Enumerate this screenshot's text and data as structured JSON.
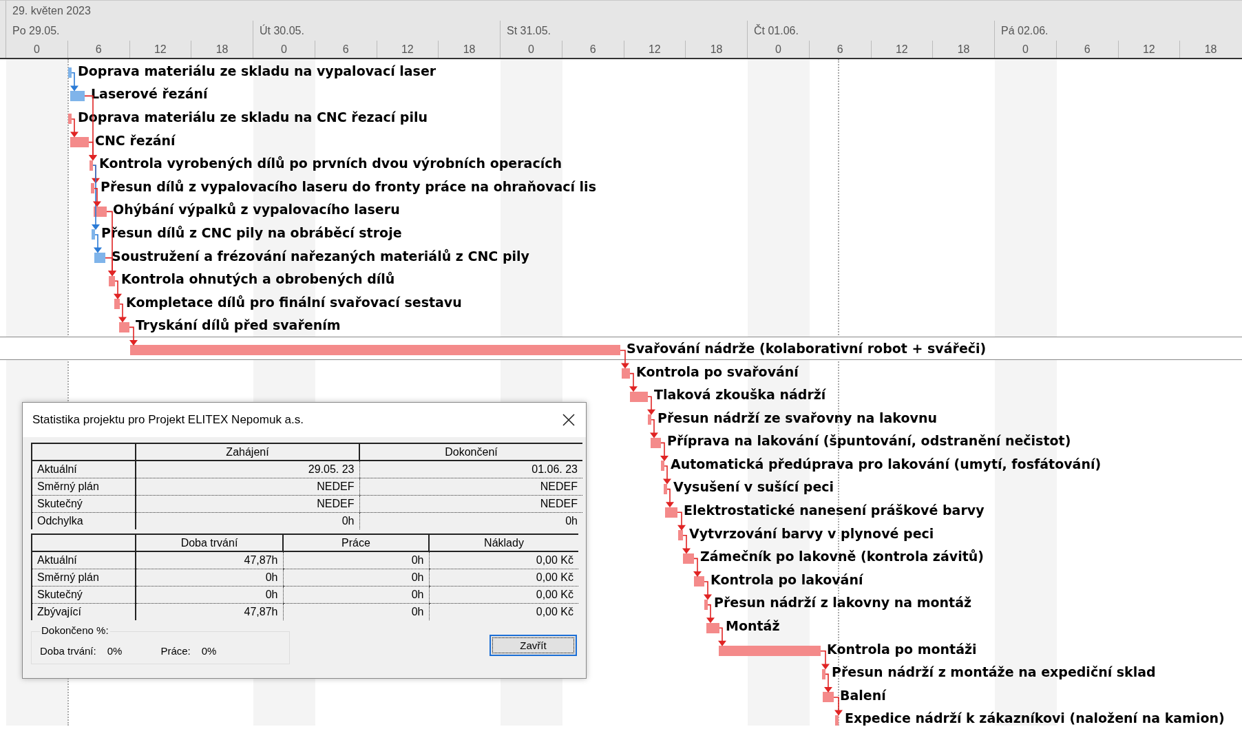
{
  "timescale": {
    "month": "29. květen 2023",
    "days": [
      {
        "label": "Po 29.05.",
        "hours": [
          "0",
          "6",
          "12",
          "18"
        ]
      },
      {
        "label": "Út 30.05.",
        "hours": [
          "0",
          "6",
          "12",
          "18"
        ]
      },
      {
        "label": "St 31.05.",
        "hours": [
          "0",
          "6",
          "12",
          "18"
        ]
      },
      {
        "label": "Čt 01.06.",
        "hours": [
          "0",
          "6",
          "12",
          "18"
        ]
      },
      {
        "label": "Pá 02.06.",
        "hours": [
          "0",
          "6",
          "12",
          "18"
        ]
      }
    ]
  },
  "tasks": [
    {
      "name": "Doprava materiálu ze skladu na vypalovací laser",
      "critical": false,
      "selected": false
    },
    {
      "name": "Laserové řezání",
      "critical": false,
      "selected": false
    },
    {
      "name": "Doprava materiálu ze skladu na CNC řezací pilu",
      "critical": true,
      "selected": false
    },
    {
      "name": "CNC řezání",
      "critical": true,
      "selected": false
    },
    {
      "name": "Kontrola vyrobených dílů po prvních dvou výrobních operacích",
      "critical": true,
      "selected": false
    },
    {
      "name": "Přesun dílů z vypalovacího laseru do fronty práce na ohraňovací lis",
      "critical": true,
      "selected": false
    },
    {
      "name": "Ohýbání výpalků z vypalovacího laseru",
      "critical": true,
      "selected": false
    },
    {
      "name": "Přesun dílů z CNC pily na obráběcí stroje",
      "critical": false,
      "selected": false
    },
    {
      "name": "Soustružení a frézování nařezaných materiálů z CNC pily",
      "critical": false,
      "selected": false
    },
    {
      "name": "Kontrola ohnutých a obrobených dílů",
      "critical": true,
      "selected": false
    },
    {
      "name": "Kompletace dílů pro finální svařovací sestavu",
      "critical": true,
      "selected": false
    },
    {
      "name": "Tryskání dílů před svařením",
      "critical": true,
      "selected": false
    },
    {
      "name": "Svařování nádrže (kolaborativní robot + svářeči)",
      "critical": true,
      "selected": true
    },
    {
      "name": "Kontrola po svařování",
      "critical": true,
      "selected": false
    },
    {
      "name": "Tlaková zkouška nádrží",
      "critical": true,
      "selected": false
    },
    {
      "name": "Přesun nádrží ze svařovny na lakovnu",
      "critical": true,
      "selected": false
    },
    {
      "name": "Příprava na lakování (špuntování, odstranění nečistot)",
      "critical": true,
      "selected": false
    },
    {
      "name": "Automatická předúprava pro lakování (umytí, fosfátování)",
      "critical": true,
      "selected": false
    },
    {
      "name": "Vysušení v sušící peci",
      "critical": true,
      "selected": false
    },
    {
      "name": "Elektrostatické nanesení práškové barvy",
      "critical": true,
      "selected": false
    },
    {
      "name": "Vytvrzování barvy v plynové peci",
      "critical": true,
      "selected": false
    },
    {
      "name": "Zámečník po lakovně (kontrola závitů)",
      "critical": true,
      "selected": false
    },
    {
      "name": "Kontrola po lakování",
      "critical": true,
      "selected": false
    },
    {
      "name": "Přesun nádrží z lakovny na montáž",
      "critical": true,
      "selected": false
    },
    {
      "name": "Montáž",
      "critical": true,
      "selected": false
    },
    {
      "name": "Kontrola po montáži",
      "critical": true,
      "selected": false
    },
    {
      "name": "Přesun nádrží z montáže na expediční sklad",
      "critical": true,
      "selected": false
    },
    {
      "name": "Balení",
      "critical": true,
      "selected": false
    },
    {
      "name": "Expedice nádrží k zákazníkovi (naložení na kamion)",
      "critical": true,
      "selected": false
    }
  ],
  "dialog": {
    "title": "Statistika projektu pro Projekt ELITEX Nepomuk a.s.",
    "dates_table": {
      "columns": [
        "Zahájení",
        "Dokončení"
      ],
      "rows": [
        {
          "label": "Aktuální",
          "values": [
            "29.05. 23",
            "01.06. 23"
          ]
        },
        {
          "label": "Směrný plán",
          "values": [
            "NEDEF",
            "NEDEF"
          ]
        },
        {
          "label": "Skutečný",
          "values": [
            "NEDEF",
            "NEDEF"
          ]
        },
        {
          "label": "Odchylka",
          "values": [
            "0h",
            "0h"
          ]
        }
      ]
    },
    "totals_table": {
      "columns": [
        "Doba trvání",
        "Práce",
        "Náklady"
      ],
      "rows": [
        {
          "label": "Aktuální",
          "values": [
            "47,87h",
            "0h",
            "0,00 Kč"
          ]
        },
        {
          "label": "Směrný plán",
          "values": [
            "0h",
            "0h",
            "0,00 Kč"
          ]
        },
        {
          "label": "Skutečný",
          "values": [
            "0h",
            "0h",
            "0,00 Kč"
          ]
        },
        {
          "label": "Zbývající",
          "values": [
            "47,87h",
            "0h",
            "0,00 Kč"
          ]
        }
      ]
    },
    "percent_complete": {
      "legend": "Dokončeno %:",
      "items": [
        {
          "label": "Doba trvání:",
          "value": "0%"
        },
        {
          "label": "Práce:",
          "value": "0%"
        }
      ]
    },
    "close_button": "Zavřít"
  }
}
